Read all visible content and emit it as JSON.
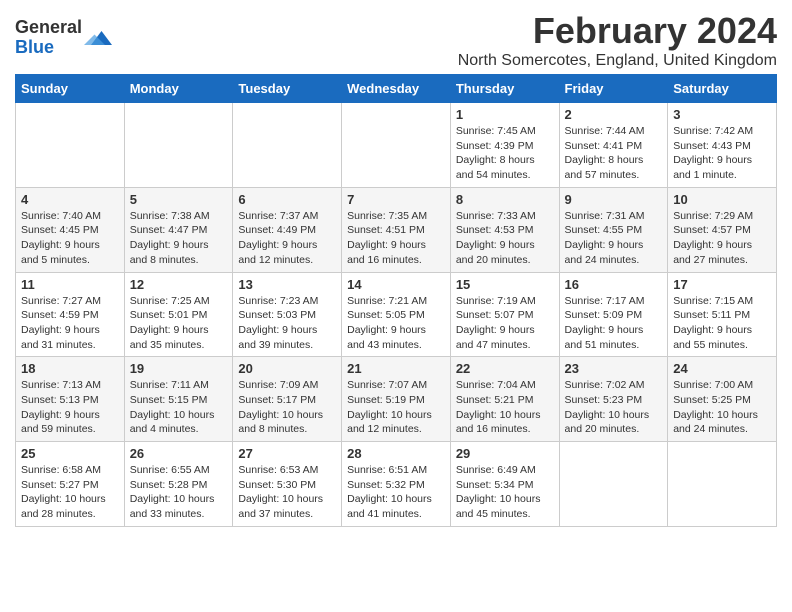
{
  "logo": {
    "general": "General",
    "blue": "Blue"
  },
  "title": "February 2024",
  "subtitle": "North Somercotes, England, United Kingdom",
  "days_of_week": [
    "Sunday",
    "Monday",
    "Tuesday",
    "Wednesday",
    "Thursday",
    "Friday",
    "Saturday"
  ],
  "weeks": [
    [
      {
        "day": "",
        "info": ""
      },
      {
        "day": "",
        "info": ""
      },
      {
        "day": "",
        "info": ""
      },
      {
        "day": "",
        "info": ""
      },
      {
        "day": "1",
        "info": "Sunrise: 7:45 AM\nSunset: 4:39 PM\nDaylight: 8 hours\nand 54 minutes."
      },
      {
        "day": "2",
        "info": "Sunrise: 7:44 AM\nSunset: 4:41 PM\nDaylight: 8 hours\nand 57 minutes."
      },
      {
        "day": "3",
        "info": "Sunrise: 7:42 AM\nSunset: 4:43 PM\nDaylight: 9 hours\nand 1 minute."
      }
    ],
    [
      {
        "day": "4",
        "info": "Sunrise: 7:40 AM\nSunset: 4:45 PM\nDaylight: 9 hours\nand 5 minutes."
      },
      {
        "day": "5",
        "info": "Sunrise: 7:38 AM\nSunset: 4:47 PM\nDaylight: 9 hours\nand 8 minutes."
      },
      {
        "day": "6",
        "info": "Sunrise: 7:37 AM\nSunset: 4:49 PM\nDaylight: 9 hours\nand 12 minutes."
      },
      {
        "day": "7",
        "info": "Sunrise: 7:35 AM\nSunset: 4:51 PM\nDaylight: 9 hours\nand 16 minutes."
      },
      {
        "day": "8",
        "info": "Sunrise: 7:33 AM\nSunset: 4:53 PM\nDaylight: 9 hours\nand 20 minutes."
      },
      {
        "day": "9",
        "info": "Sunrise: 7:31 AM\nSunset: 4:55 PM\nDaylight: 9 hours\nand 24 minutes."
      },
      {
        "day": "10",
        "info": "Sunrise: 7:29 AM\nSunset: 4:57 PM\nDaylight: 9 hours\nand 27 minutes."
      }
    ],
    [
      {
        "day": "11",
        "info": "Sunrise: 7:27 AM\nSunset: 4:59 PM\nDaylight: 9 hours\nand 31 minutes."
      },
      {
        "day": "12",
        "info": "Sunrise: 7:25 AM\nSunset: 5:01 PM\nDaylight: 9 hours\nand 35 minutes."
      },
      {
        "day": "13",
        "info": "Sunrise: 7:23 AM\nSunset: 5:03 PM\nDaylight: 9 hours\nand 39 minutes."
      },
      {
        "day": "14",
        "info": "Sunrise: 7:21 AM\nSunset: 5:05 PM\nDaylight: 9 hours\nand 43 minutes."
      },
      {
        "day": "15",
        "info": "Sunrise: 7:19 AM\nSunset: 5:07 PM\nDaylight: 9 hours\nand 47 minutes."
      },
      {
        "day": "16",
        "info": "Sunrise: 7:17 AM\nSunset: 5:09 PM\nDaylight: 9 hours\nand 51 minutes."
      },
      {
        "day": "17",
        "info": "Sunrise: 7:15 AM\nSunset: 5:11 PM\nDaylight: 9 hours\nand 55 minutes."
      }
    ],
    [
      {
        "day": "18",
        "info": "Sunrise: 7:13 AM\nSunset: 5:13 PM\nDaylight: 9 hours\nand 59 minutes."
      },
      {
        "day": "19",
        "info": "Sunrise: 7:11 AM\nSunset: 5:15 PM\nDaylight: 10 hours\nand 4 minutes."
      },
      {
        "day": "20",
        "info": "Sunrise: 7:09 AM\nSunset: 5:17 PM\nDaylight: 10 hours\nand 8 minutes."
      },
      {
        "day": "21",
        "info": "Sunrise: 7:07 AM\nSunset: 5:19 PM\nDaylight: 10 hours\nand 12 minutes."
      },
      {
        "day": "22",
        "info": "Sunrise: 7:04 AM\nSunset: 5:21 PM\nDaylight: 10 hours\nand 16 minutes."
      },
      {
        "day": "23",
        "info": "Sunrise: 7:02 AM\nSunset: 5:23 PM\nDaylight: 10 hours\nand 20 minutes."
      },
      {
        "day": "24",
        "info": "Sunrise: 7:00 AM\nSunset: 5:25 PM\nDaylight: 10 hours\nand 24 minutes."
      }
    ],
    [
      {
        "day": "25",
        "info": "Sunrise: 6:58 AM\nSunset: 5:27 PM\nDaylight: 10 hours\nand 28 minutes."
      },
      {
        "day": "26",
        "info": "Sunrise: 6:55 AM\nSunset: 5:28 PM\nDaylight: 10 hours\nand 33 minutes."
      },
      {
        "day": "27",
        "info": "Sunrise: 6:53 AM\nSunset: 5:30 PM\nDaylight: 10 hours\nand 37 minutes."
      },
      {
        "day": "28",
        "info": "Sunrise: 6:51 AM\nSunset: 5:32 PM\nDaylight: 10 hours\nand 41 minutes."
      },
      {
        "day": "29",
        "info": "Sunrise: 6:49 AM\nSunset: 5:34 PM\nDaylight: 10 hours\nand 45 minutes."
      },
      {
        "day": "",
        "info": ""
      },
      {
        "day": "",
        "info": ""
      }
    ]
  ]
}
